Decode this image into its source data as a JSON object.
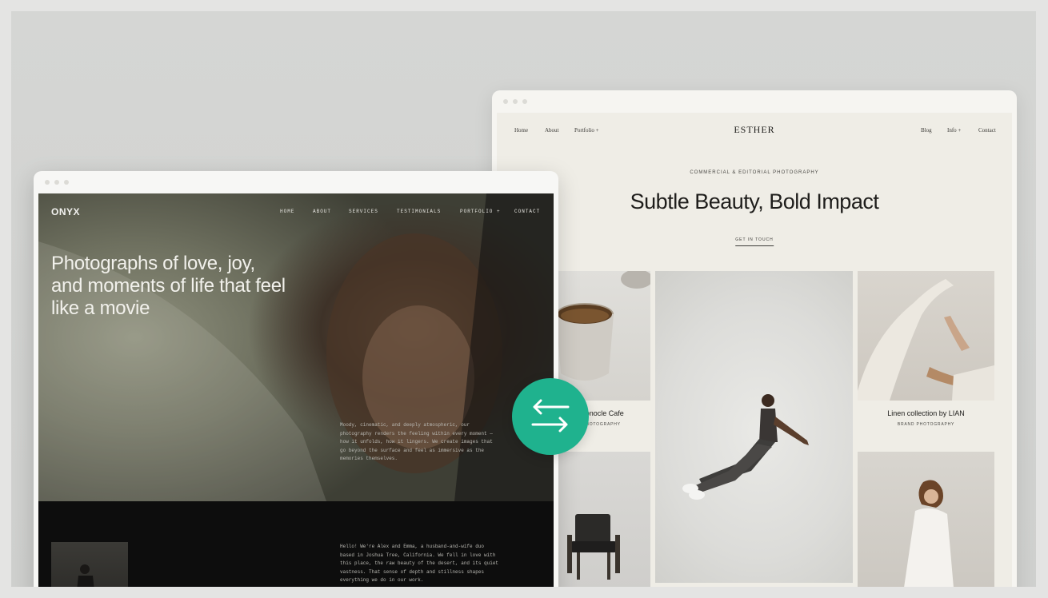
{
  "left_site": {
    "logo": "ONYX",
    "nav": [
      "HOME",
      "ABOUT",
      "SERVICES",
      "TESTIMONIALS",
      "PORTFOLIO +",
      "CONTACT"
    ],
    "headline": "Photographs of love, joy, and moments of life that feel like a movie",
    "intro": "Moody, cinematic, and deeply atmospheric, our photography renders the feeling within every moment — how it unfolds, how it lingers. We create images that go beyond the surface and feel as immersive as the memories themselves.",
    "about": "Hello! We're Alex and Emma, a husband-and-wife duo based in Joshua Tree, California. We fell in love with this place, the raw beauty of the desert, and its quiet vastness. That sense of depth and stillness shapes everything we do in our work."
  },
  "right_site": {
    "logo": "ESTHER",
    "nav_left": [
      "Home",
      "About",
      "Portfolio +"
    ],
    "nav_right": [
      "Blog",
      "Info +",
      "Contact"
    ],
    "eyebrow": "COMMERCIAL & EDITORIAL PHOTOGRAPHY",
    "headline": "Subtle Beauty, Bold Impact",
    "cta": "GET IN TOUCH",
    "gallery": [
      {
        "title": "Monocle Cafe",
        "subtitle": "PHOTOGRAPHY"
      },
      {
        "title": "Linen collection by LIAN",
        "subtitle": "BRAND PHOTOGRAPHY"
      }
    ]
  },
  "swap_button": {
    "icon": "swap-arrows-icon",
    "color": "#1fb28e"
  },
  "colors": {
    "onyx_bg": "#0d0d0d",
    "esther_bg": "#efede6",
    "accent": "#1fb28e"
  }
}
